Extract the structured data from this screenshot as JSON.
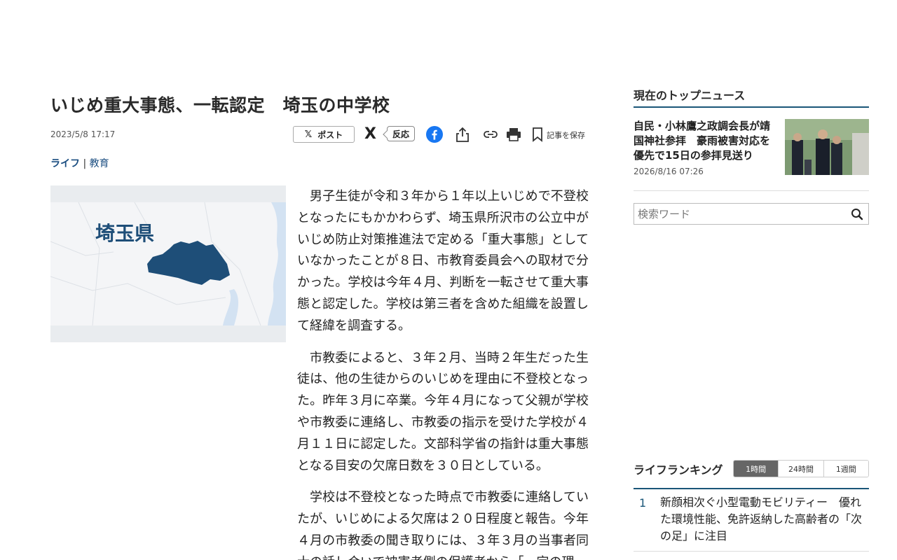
{
  "article": {
    "headline": "いじめ重大事態、一転認定　埼玉の中学校",
    "date": "2023/5/8 17:17",
    "category_main": "ライフ",
    "category_separator": "|",
    "category_sub": "教育",
    "photo_label": "埼玉県",
    "paragraphs": [
      "男子生徒が令和３年から１年以上いじめで不登校となったにもかかわらず、埼玉県所沢市の公立中がいじめ防止対策推進法で定める「重大事態」としていなかったことが８日、市教育委員会への取材で分かった。学校は今年４月、判断を一転させて重大事態と認定した。学校は第三者を含めた組織を設置して経緯を調査する。",
      "市教委によると、３年２月、当時２年生だった生徒は、他の生徒からのいじめを理由に不登校となった。昨年３月に卒業。今年４月になって父親が学校や市教委に連絡し、市教委の指示を受けた学校が４月１１日に認定した。文部科学省の指針は重大事態となる目安の欠席日数を３０日としている。",
      "学校は不登校となった時点で市教委に連絡していたが、いじめによる欠席は２０日程度と報告。今年４月の市教委の聞き取りには、３年３月の当事者同士の話し合いで被害者側の保護者から「一定の理"
    ]
  },
  "share": {
    "post_label": "ポスト",
    "x_glyph": "𝕏",
    "x_icon_glyph": "X",
    "reaction_label": "反応",
    "save_label": "記事を保存"
  },
  "sidebar": {
    "top_news_title": "現在のトップニュース",
    "top_news": {
      "title": "自民・小林鷹之政調会長が靖国神社参拝　豪雨被害対応を優先で15日の参拝見送り",
      "date": "2026/8/16 07:26"
    },
    "search": {
      "placeholder": "検索ワード"
    },
    "ranking": {
      "title": "ライフランキング",
      "tabs": [
        "1時間",
        "24時間",
        "1週間"
      ],
      "items": [
        {
          "rank": "1",
          "text": "新顔相次ぐ小型電動モビリティー　優れた環境性能、免許返納した高齢者の「次の足」に注目"
        }
      ]
    }
  },
  "colors": {
    "accent": "#1a5678",
    "link": "#1a4d80",
    "map_region": "#1e4e78",
    "facebook": "#1877f2"
  }
}
